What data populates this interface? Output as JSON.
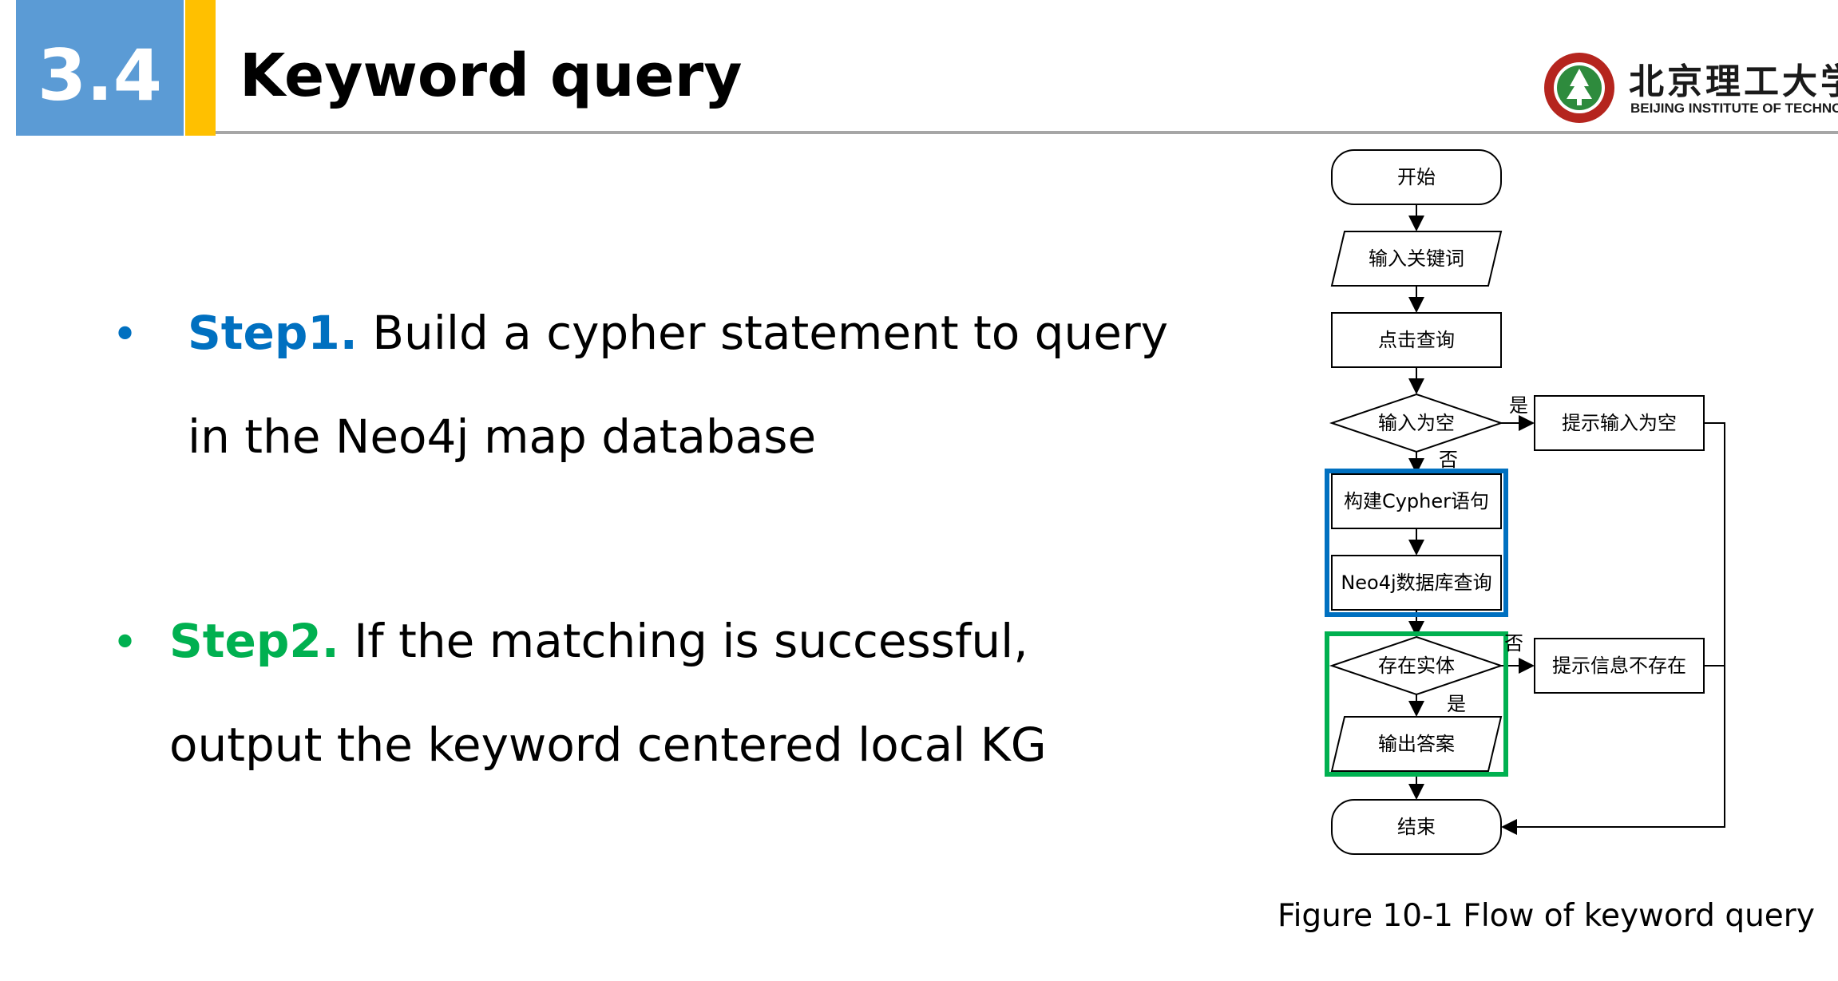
{
  "header": {
    "section_number": "3.4",
    "title": "Keyword query",
    "logo_cn": "北京理工大学",
    "logo_en": "BEIJING INSTITUTE OF TECHNOLOGY"
  },
  "steps": [
    {
      "label": "Step1.",
      "line1": "Build a cypher statement to query",
      "line2": "in the Neo4j map database",
      "color": "#0070c0"
    },
    {
      "label": "Step2.",
      "line1": "If the matching is successful,",
      "line2": "output the keyword centered local KG",
      "color": "#00b050"
    }
  ],
  "flowchart": {
    "start": "开始",
    "input_keyword": "输入关键词",
    "click_query": "点击查询",
    "input_empty": "输入为空",
    "yes_1": "是",
    "no_1": "否",
    "prompt_empty": "提示输入为空",
    "build_cypher": "构建Cypher语句",
    "neo4j_query": "Neo4j数据库查询",
    "entity_exists": "存在实体",
    "no_2": "否",
    "yes_2": "是",
    "prompt_not_exist": "提示信息不存在",
    "output_answer": "输出答案",
    "end": "结束",
    "highlight_blue": "#0070c0",
    "highlight_green": "#00b050"
  },
  "caption": "Figure 10-1 Flow of keyword query"
}
